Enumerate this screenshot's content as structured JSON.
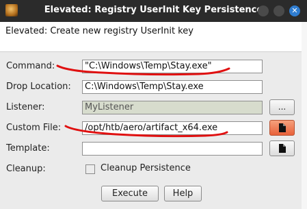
{
  "window": {
    "title": "Elevated: Registry UserInit Key Persistence"
  },
  "description": "Elevated: Create new registry UserInit key",
  "form": {
    "command": {
      "label": "Command:",
      "value": "\"C:\\Windows\\Temp\\Stay.exe\""
    },
    "drop_location": {
      "label": "Drop Location:",
      "value": "C:\\Windows\\Temp\\Stay.exe"
    },
    "listener": {
      "label": "Listener:",
      "value": "MyListener",
      "button": "..."
    },
    "custom_file": {
      "label": "Custom File:",
      "value": "/opt/htb/aero/artifact_x64.exe"
    },
    "template": {
      "label": "Template:",
      "value": ""
    },
    "cleanup": {
      "label": "Cleanup:",
      "checkbox_label": "Cleanup Persistence",
      "checked": false
    }
  },
  "buttons": {
    "execute": "Execute",
    "help": "Help"
  },
  "colors": {
    "titlebar": "#2b2b2b",
    "close_button": "#2f7dd1",
    "annotation": "#e01010",
    "custom_file_button": "#e8613a"
  }
}
